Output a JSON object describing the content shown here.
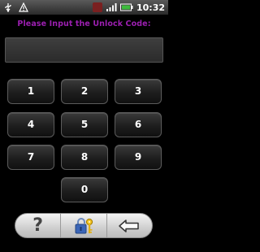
{
  "status_bar": {
    "time": "10:32",
    "icons": [
      "usb-icon",
      "warning-icon",
      "network-badge-icon",
      "signal-icon",
      "battery-icon"
    ]
  },
  "prompt": "Please Input the Unlock Code:",
  "code_field": {
    "value": ""
  },
  "keypad": {
    "keys": [
      "1",
      "2",
      "3",
      "4",
      "5",
      "6",
      "7",
      "8",
      "9",
      "0"
    ]
  },
  "bottom_bar": {
    "buttons": [
      "help-icon",
      "unlock-key-icon",
      "backspace-arrow-icon"
    ]
  },
  "colors": {
    "prompt": "#9b1fb0",
    "background": "#000000"
  }
}
